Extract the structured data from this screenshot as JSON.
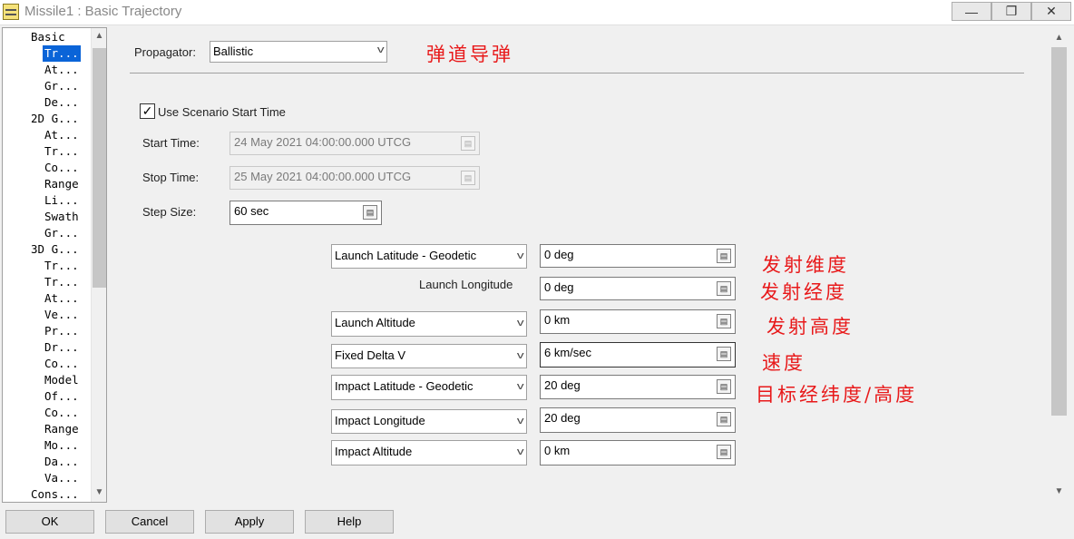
{
  "window": {
    "title": "Missile1 : Basic Trajectory",
    "minimize": "—",
    "maximize": "❐",
    "close": "✕"
  },
  "tree": {
    "items": [
      "Basic",
      "Tr...",
      "At...",
      "Gr...",
      "De...",
      "2D G...",
      "At...",
      "Tr...",
      "Co...",
      "Range",
      "Li...",
      "Swath",
      "Gr...",
      "3D G...",
      "Tr...",
      "Tr...",
      "At...",
      "Ve...",
      "Pr...",
      "Dr...",
      "Co...",
      "Model",
      "Of...",
      "Co...",
      "Range",
      "Mo...",
      "Da...",
      "Va...",
      "Cons..."
    ],
    "selected_index": 1
  },
  "propagator": {
    "label": "Propagator:",
    "value": "Ballistic",
    "annotation": "弹道导弹"
  },
  "use_scenario": {
    "label": "Use Scenario Start Time",
    "checked": true
  },
  "start_time": {
    "label": "Start Time:",
    "value": "24 May 2021 04:00:00.000 UTCG"
  },
  "stop_time": {
    "label": "Stop Time:",
    "value": "25 May 2021 04:00:00.000 UTCG"
  },
  "step_size": {
    "label": "Step Size:",
    "value": "60 sec"
  },
  "params": {
    "launch_lat": {
      "label": "Launch Latitude - Geodetic",
      "value": "0 deg"
    },
    "launch_lon": {
      "label": "Launch Longitude",
      "value": "0 deg"
    },
    "launch_alt": {
      "label": "Launch Altitude",
      "value": "0 km"
    },
    "delta_v": {
      "label": "Fixed Delta V",
      "value": "6 km/sec"
    },
    "impact_lat": {
      "label": "Impact Latitude - Geodetic",
      "value": "20 deg"
    },
    "impact_lon": {
      "label": "Impact Longitude",
      "value": "20 deg"
    },
    "impact_alt": {
      "label": "Impact Altitude",
      "value": "0 km"
    }
  },
  "annotations": {
    "launch_lat": "发射维度",
    "launch_lon": "发射经度",
    "launch_alt": "发射高度",
    "speed": "速度",
    "target": "目标经纬度/高度"
  },
  "buttons": {
    "ok": "OK",
    "cancel": "Cancel",
    "apply": "Apply",
    "help": "Help"
  },
  "icons": {
    "unit_button": "unit-selector-icon",
    "chevron": "chevron-down-icon",
    "scroll_up": "▲",
    "scroll_down": "▼"
  }
}
